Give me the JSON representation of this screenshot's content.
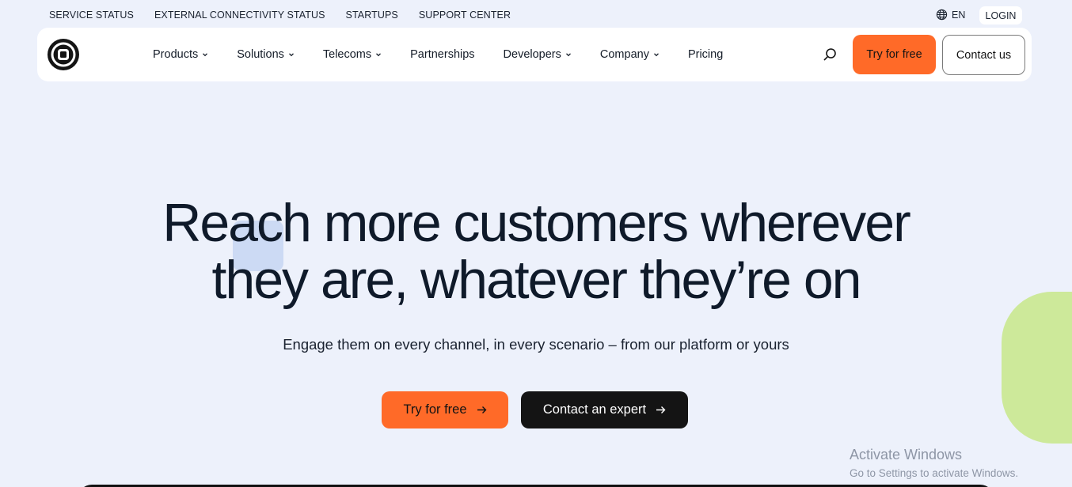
{
  "utility_bar": {
    "links": [
      "SERVICE STATUS",
      "EXTERNAL CONNECTIVITY STATUS",
      "STARTUPS",
      "SUPPORT CENTER"
    ],
    "language": "EN",
    "login_label": "LOGIN"
  },
  "nav": {
    "items": [
      {
        "label": "Products",
        "has_dropdown": true
      },
      {
        "label": "Solutions",
        "has_dropdown": true
      },
      {
        "label": "Telecoms",
        "has_dropdown": true
      },
      {
        "label": "Partnerships",
        "has_dropdown": false
      },
      {
        "label": "Developers",
        "has_dropdown": true
      },
      {
        "label": "Company",
        "has_dropdown": true
      },
      {
        "label": "Pricing",
        "has_dropdown": false
      }
    ],
    "try_label": "Try for free",
    "contact_label": "Contact us"
  },
  "hero": {
    "title_line1": "Reach more customers wherever",
    "title_line2": "they are, whatever they’re on",
    "subtitle": "Engage them on every channel, in every scenario – from our platform or yours",
    "cta_primary": "Try for free",
    "cta_secondary": "Contact an expert"
  },
  "watermark": {
    "line1": "Activate Windows",
    "line2": "Go to Settings to activate Windows."
  },
  "colors": {
    "page_bg": "#edf1fb",
    "accent_orange": "#ff6a28",
    "dark": "#141414",
    "deco_green": "#cde99a",
    "deco_blue": "#ccdaf4"
  },
  "icons": {
    "logo": "logo-icon",
    "globe": "globe-icon",
    "search": "search-icon",
    "chevron": "chevron-down-icon",
    "arrow": "arrow-right-icon"
  }
}
